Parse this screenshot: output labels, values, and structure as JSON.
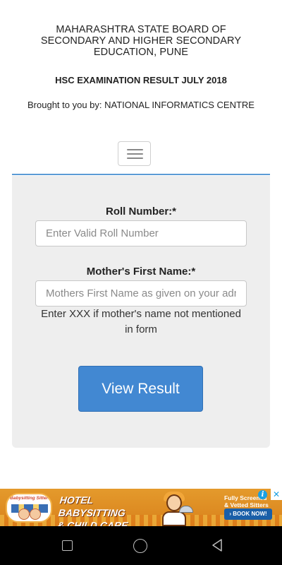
{
  "header": {
    "org_line1": "MAHARASHTRA STATE BOARD OF",
    "org_line2": "SECONDARY AND HIGHER SECONDARY",
    "org_line3": "EDUCATION, PUNE",
    "exam_title": "HSC EXAMINATION RESULT JULY 2018",
    "brought_by": "Brought to you by: NATIONAL INFORMATICS CENTRE",
    "menu_icon": "hamburger-menu-icon"
  },
  "form": {
    "roll_label": "Roll Number:*",
    "roll_value": "",
    "roll_placeholder": "Enter Valid Roll Number",
    "mother_label": "Mother's First Name:*",
    "mother_value": "",
    "mother_placeholder": "Mothers First Name as given on your admit card",
    "hint_line1": "Enter XXX if mother's name not mentioned",
    "hint_line2": "in form",
    "submit_label": "View Result"
  },
  "ad": {
    "logo_text": "Babysitting Sitters",
    "headline_line1": "HOTEL BABYSITTING",
    "headline_line2": "& CHILD CARE SERVICE",
    "tagline_line1": "Fully Screened",
    "tagline_line2": "& Vetted Sitters",
    "cta": "› BOOK NOW!",
    "info_icon": "i",
    "close_icon": "✕"
  },
  "colors": {
    "accent": "#5b9bd5",
    "button": "#4288d2",
    "panel": "#eeeeee"
  }
}
